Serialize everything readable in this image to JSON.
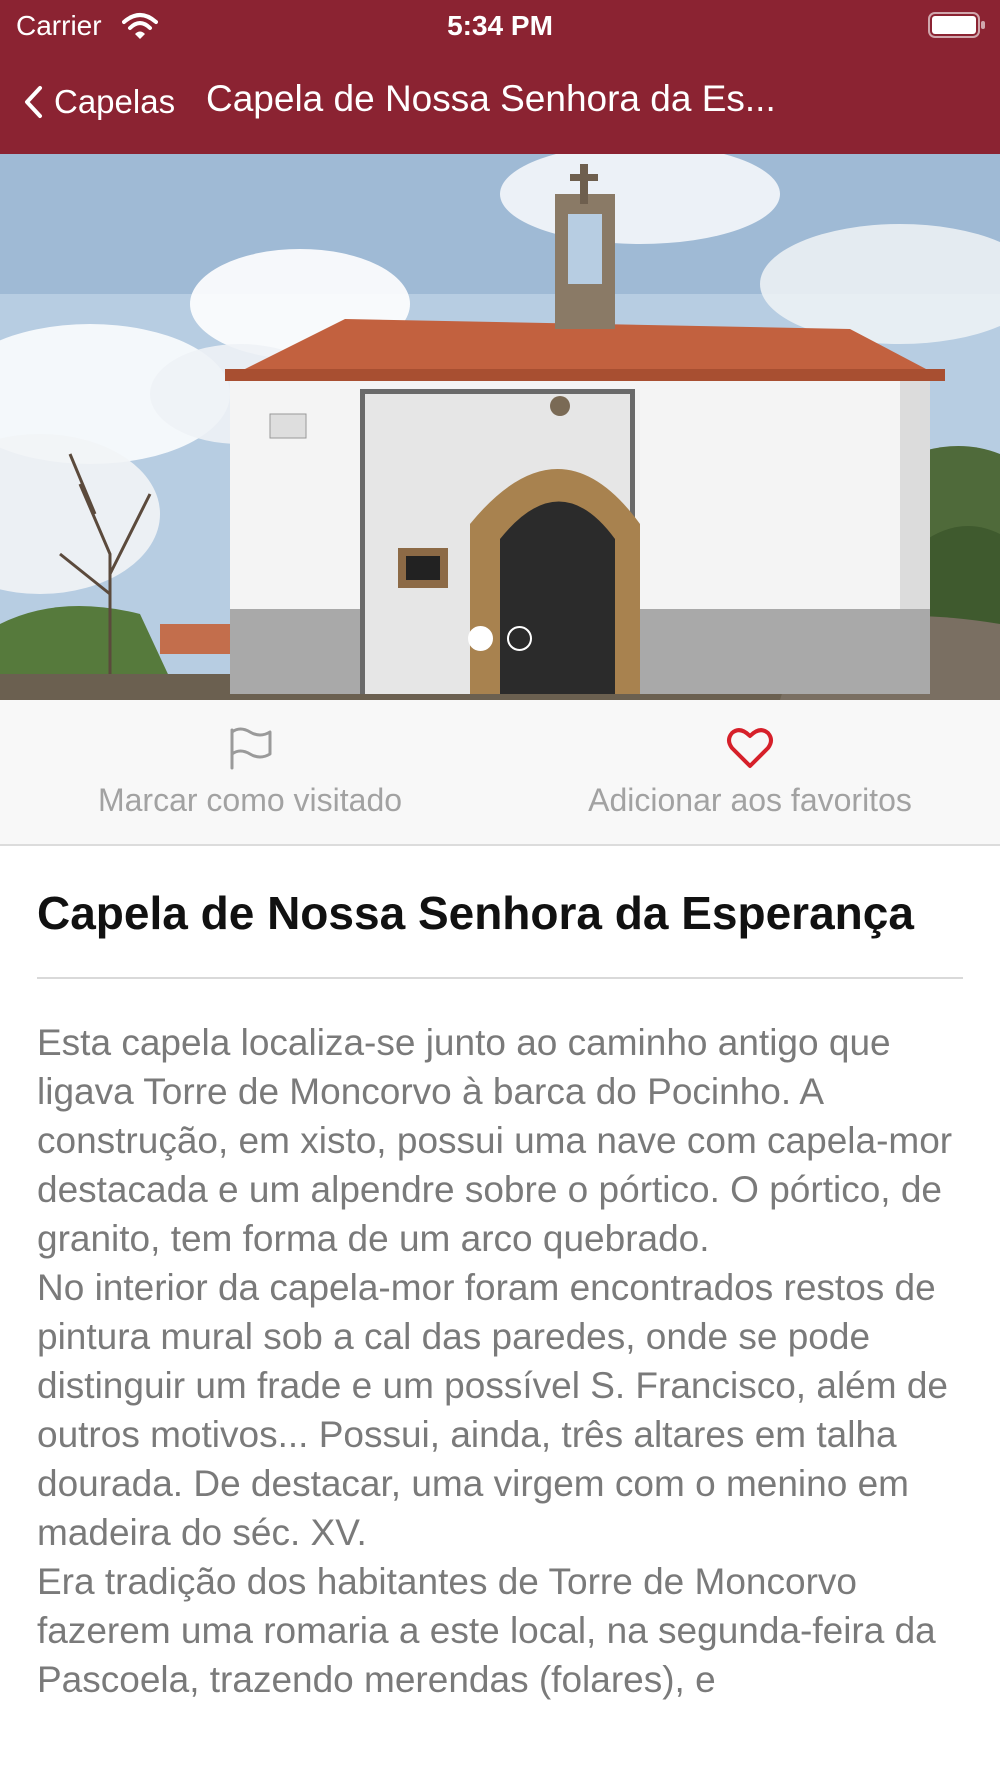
{
  "status_bar": {
    "carrier": "Carrier",
    "time": "5:34 PM"
  },
  "nav": {
    "back_label": "Capelas",
    "title": "Capela de Nossa Senhora da Es..."
  },
  "gallery": {
    "page_count": 2,
    "current_page": 1
  },
  "actions": {
    "visited_label": "Marcar como visitado",
    "favorite_label": "Adicionar aos favoritos"
  },
  "detail": {
    "title": "Capela de Nossa Senhora da Esperança",
    "description": "Esta capela localiza-se junto ao caminho antigo que ligava Torre de Moncorvo à barca do Pocinho. A construção, em xisto, possui uma nave com capela-mor destacada e um alpendre sobre o pórtico. O pórtico, de granito, tem forma de um arco quebrado.\nNo interior da capela-mor foram encontrados restos de pintura mural sob a cal das paredes, onde se pode distinguir um frade e um possível S. Francisco, além de outros motivos... Possui, ainda, três altares em talha dourada. De destacar, uma virgem com o menino em madeira do séc. XV.\nEra tradição dos habitantes de Torre de Moncorvo fazerem uma romaria a este local, na segunda-feira da Pascoela, trazendo merendas (folares), e"
  },
  "colors": {
    "header": "#8b2332",
    "favorite_heart": "#d6202a",
    "muted_text": "#a2a2a2"
  },
  "icons": {
    "back": "chevron-left-icon",
    "visited": "flag-icon",
    "favorite": "heart-icon"
  }
}
